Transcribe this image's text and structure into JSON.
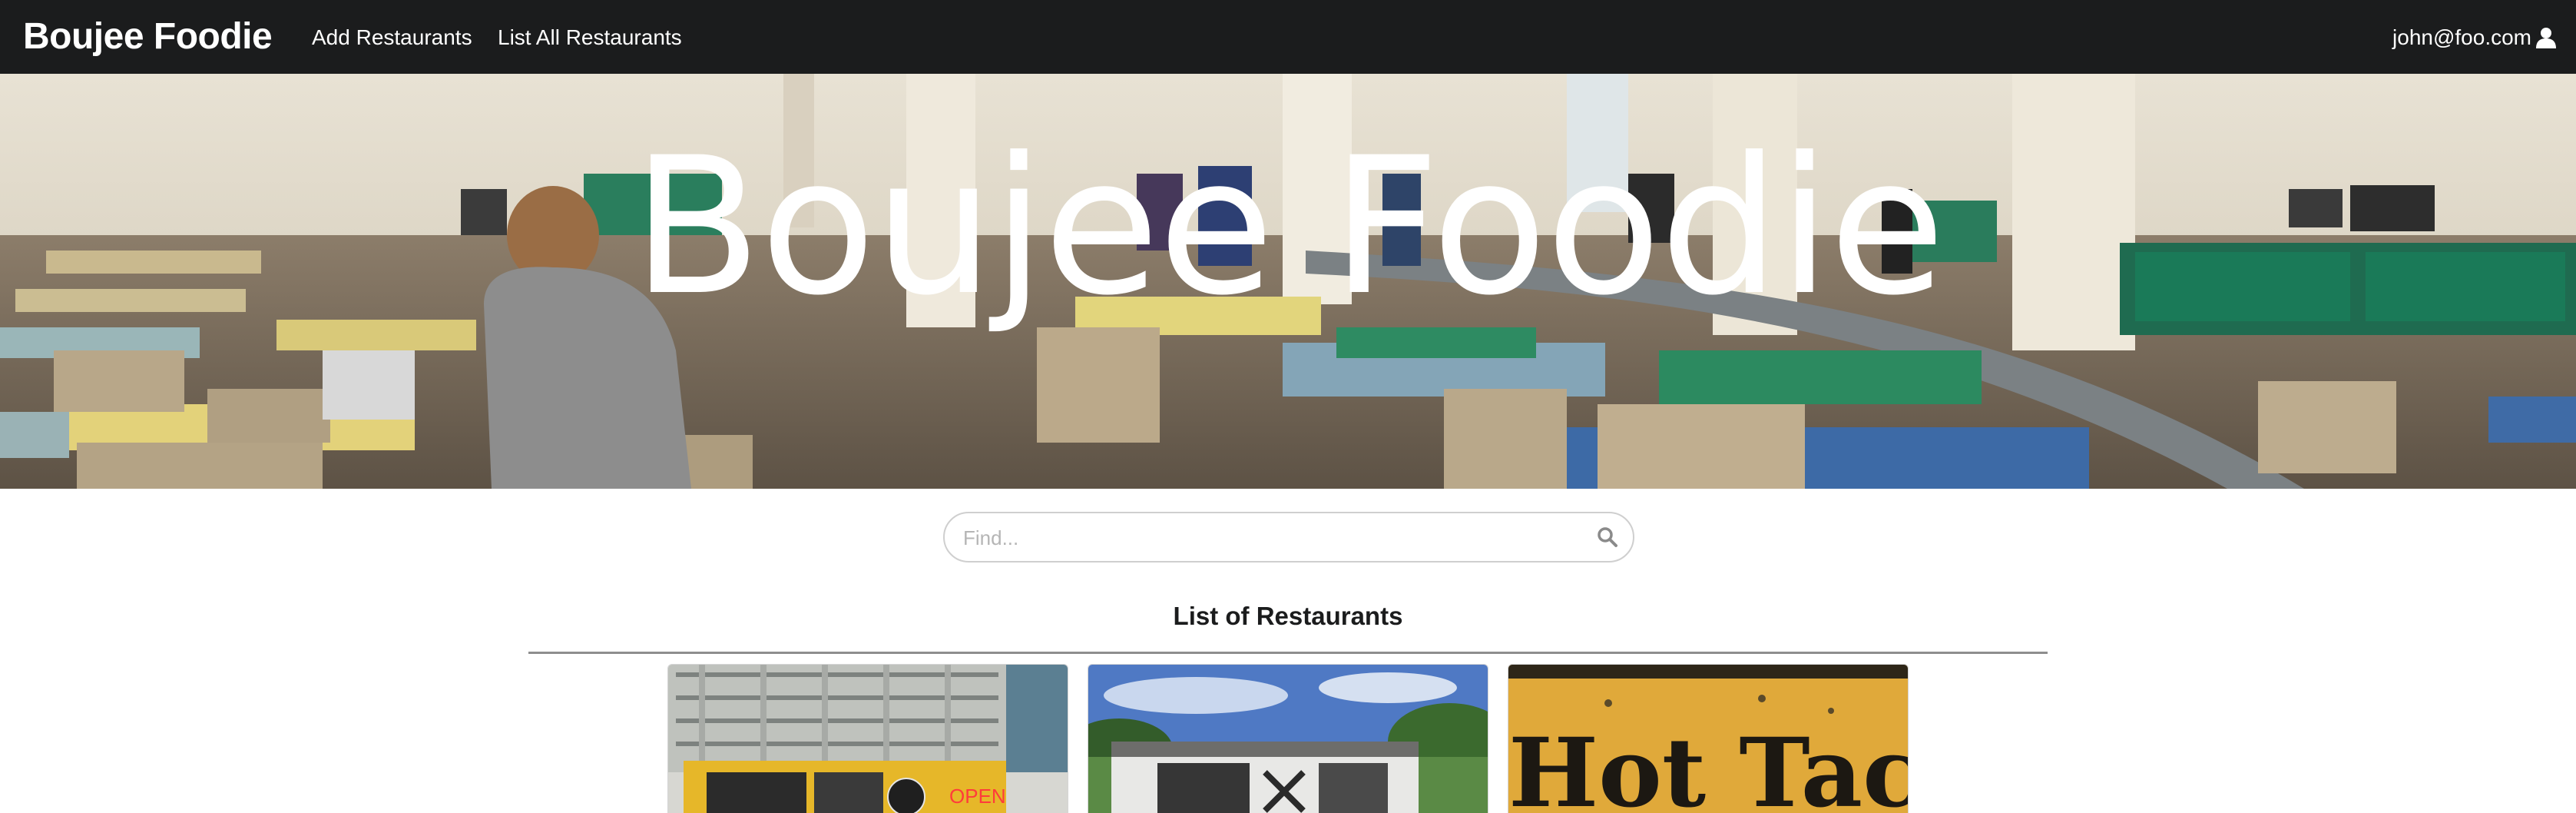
{
  "nav": {
    "brand": "Boujee Foodie",
    "links": [
      {
        "label": "Add Restaurants"
      },
      {
        "label": "List All Restaurants"
      }
    ],
    "user": {
      "email": "john@foo.com",
      "icon": "user-icon"
    }
  },
  "hero": {
    "title": "Boujee Foodie"
  },
  "search": {
    "placeholder": "Find...",
    "icon": "search-icon"
  },
  "list": {
    "title": "List of Restaurants",
    "cards": [
      {
        "image_text": "OPEN"
      },
      {
        "image_text": ""
      },
      {
        "image_text": "Hot Tacos"
      }
    ]
  }
}
